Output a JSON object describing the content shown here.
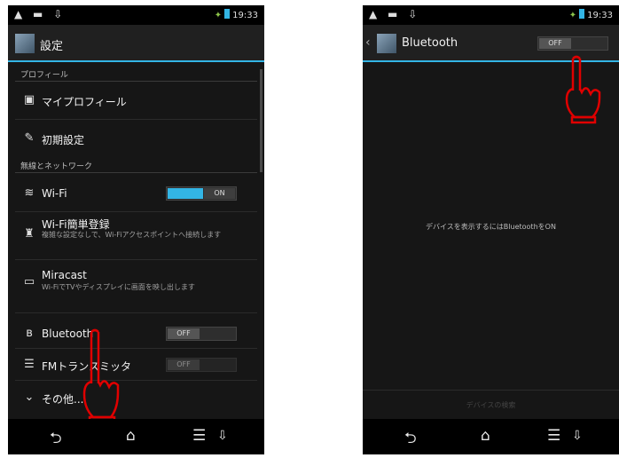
{
  "left_screen": {
    "status": {
      "left_icons": "▲ ▬ ⇩",
      "time": "19:33"
    },
    "actionbar": {
      "title": "設定"
    },
    "sections": {
      "profile": "プロフィール",
      "network": "無線とネットワーク"
    },
    "items": {
      "my_profile": "マイプロフィール",
      "initial_settings": "初期設定",
      "wifi": "Wi-Fi",
      "wifi_easy": {
        "title": "Wi-Fi簡単登録",
        "subtitle": "複雑な設定なしで、Wi-Fiアクセスポイントへ接続します"
      },
      "miracast": {
        "title": "Miracast",
        "subtitle": "Wi-FiでTVやディスプレイに画面を映し出します"
      },
      "bluetooth": "Bluetooth",
      "fm_transmitter": "FMトランスミッタ",
      "others": "その他..."
    },
    "toggles": {
      "wifi": "ON",
      "bluetooth": "OFF",
      "fm": "OFF"
    }
  },
  "right_screen": {
    "status": {
      "left_icons": "▲ ▬ ⇩",
      "time": "19:33"
    },
    "actionbar": {
      "title": "Bluetooth",
      "toggle": "OFF"
    },
    "message": "デバイスを表示するにはBluetoothをON",
    "bottom_button": "デバイスの検索"
  },
  "icons": {
    "back": "back-icon",
    "home": "home-icon",
    "menu": "menu-icon",
    "pointer": "pointing-hand-icon"
  },
  "colors": {
    "accent": "#33b5e5",
    "hand": "#e00000"
  }
}
